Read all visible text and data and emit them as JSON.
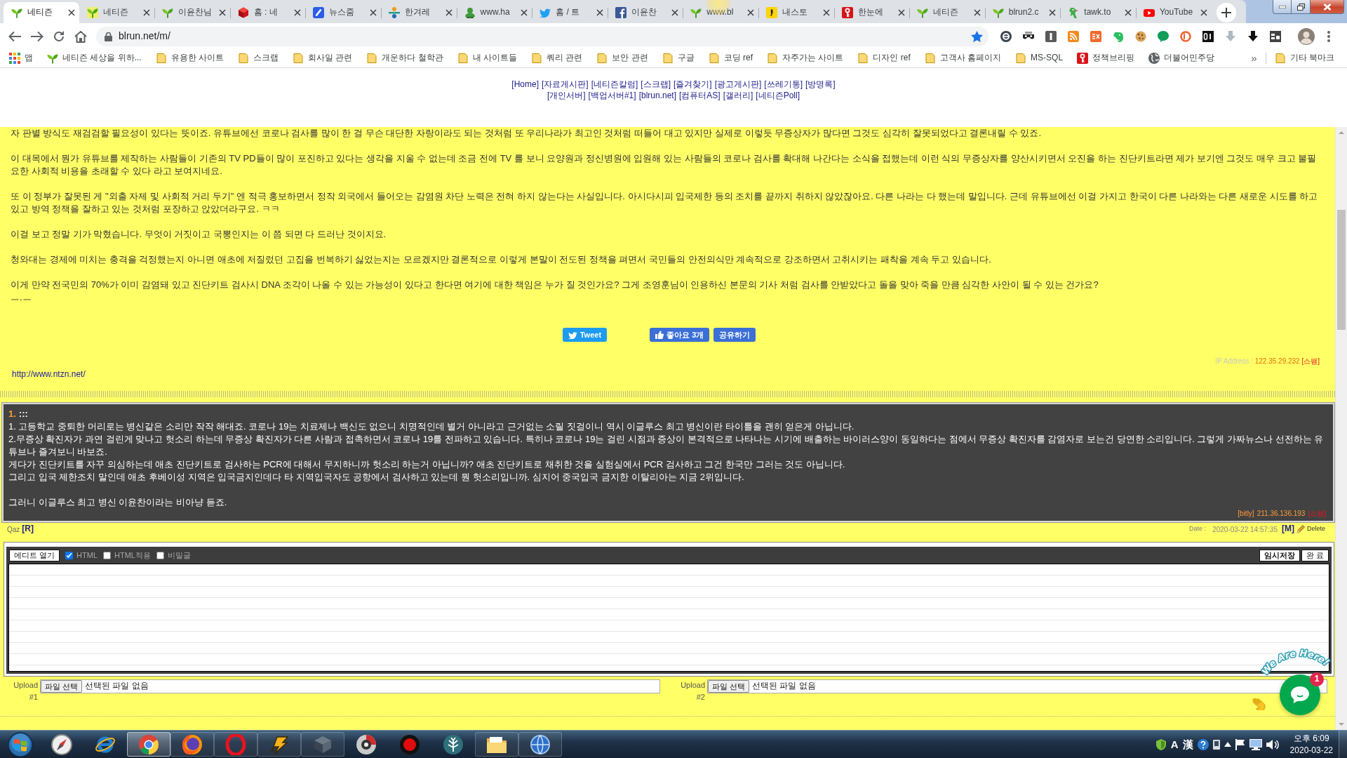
{
  "browser": {
    "tabs": [
      {
        "title": "네티즌",
        "kind": "sprout",
        "selected": true
      },
      {
        "title": "네티즌",
        "kind": "sprout-tile",
        "selected": false
      },
      {
        "title": "이윤찬님",
        "kind": "sprout",
        "selected": false
      },
      {
        "title": "홈 : 네",
        "kind": "cube",
        "selected": false
      },
      {
        "title": "뉴스줌",
        "kind": "slash-tile",
        "selected": false
      },
      {
        "title": "한겨레",
        "kind": "dots-bar",
        "selected": false
      },
      {
        "title": "www.ha",
        "kind": "person",
        "selected": false
      },
      {
        "title": "홈 / 트",
        "kind": "bird",
        "selected": false
      },
      {
        "title": "이윤찬",
        "kind": "f-tile",
        "selected": false
      },
      {
        "title": "www.bl",
        "kind": "sprout",
        "selected": false
      },
      {
        "title": "내스토",
        "kind": "story",
        "selected": false
      },
      {
        "title": "한눈에",
        "kind": "key",
        "selected": false
      },
      {
        "title": "네티즌",
        "kind": "sprout",
        "selected": false
      },
      {
        "title": "blrun2.c",
        "kind": "sprout",
        "selected": false
      },
      {
        "title": "tawk.to",
        "kind": "parrot",
        "selected": false
      },
      {
        "title": "YouTube",
        "kind": "play",
        "selected": false
      }
    ],
    "address": {
      "url": "blrun.net/m/"
    },
    "bookmarks": [
      {
        "label": "앱",
        "kind": "apps"
      },
      {
        "label": "네티즌 세상을 위하...",
        "kind": "sprout"
      },
      {
        "label": "유용한 사이트",
        "kind": "folder"
      },
      {
        "label": "스크랩",
        "kind": "folder"
      },
      {
        "label": "회사일 관련",
        "kind": "folder"
      },
      {
        "label": "개운하다 철학관",
        "kind": "folder"
      },
      {
        "label": "내 사이트들",
        "kind": "folder"
      },
      {
        "label": "쿼리 관련",
        "kind": "folder"
      },
      {
        "label": "보안 관련",
        "kind": "folder"
      },
      {
        "label": "구글",
        "kind": "folder"
      },
      {
        "label": "코딩 ref",
        "kind": "folder"
      },
      {
        "label": "자주가는 사이트",
        "kind": "folder"
      },
      {
        "label": "디자인 ref",
        "kind": "folder"
      },
      {
        "label": "고객사 홈페이지",
        "kind": "folder"
      },
      {
        "label": "MS-SQL",
        "kind": "folder"
      },
      {
        "label": "정책브리핑",
        "kind": "key"
      },
      {
        "label": "더불어민주당",
        "kind": "globe"
      }
    ],
    "bookmarks_more": "»",
    "other_bookmarks": "기타 북마크"
  },
  "site_nav": [
    {
      "links": [
        "[Home]",
        "[자료게시판]",
        "[네티즌칼럼]",
        "[스크랩]",
        "[즐겨찾기]",
        "[광고게시판]",
        "[쓰레기통]",
        "[방명록]"
      ]
    },
    {
      "links": [
        "[개인서버]",
        "[백업서버#1]",
        "[blrun.net]",
        "[컴퓨터AS]",
        "[갤러리]",
        "[네티즌Poll]"
      ]
    }
  ],
  "article": {
    "paragraphs": [
      "자 판별 방식도 재검검할 필요성이 있다는 뜻이죠. 유튜브에선 코로나 검사를 많이 한 걸 무슨 대단한 자랑이라도 되는 것처럼 또 우리나라가 최고인 것처럼 떠들어 대고 있지만 실제로 이렇듯 무증상자가 많다면 그것도 심각히 잘못되었다고 결론내릴 수 있죠.",
      "이 대목에서 뭔가 유튜브를 제작하는 사람들이 기존의 TV PD들이 많이 포진하고 있다는 생각을 지울 수 없는데 조금 전에 TV 를 보니 요양원과 정신병원에 입원해 있는 사람들의 코로나 검사를 확대해 나간다는 소식을 접했는데 이런 식의 무증상자를 양산시키면서 오진을 하는 진단키트라면 제가 보기엔 그것도 매우 크고 불필요한 사회적 비용을 초래할 수 있다 라고 보여지네요.",
      "또 이 정부가 잘못된 게 \"외출 자제 및 사회적 거리 두기\" 엔 적극 홍보하면서 정작 외국에서 들어오는 감염원 차단 노력은 전혀 하지 않는다는 사실입니다. 아시다시피 입국제한 등의 조치를 끝까지 취하지 않았잖아요. 다른 나라는 다 했는데 말입니다. 근데 유튜브에선 이걸 가지고 한국이 다른 나라와는 다른 새로운 시도를 하고 있고 방역 정책을 잘하고 있는 것처럼 포장하고 앉았더라구요. ㅋㅋ",
      "이걸 보고 정말 기가 막혔습니다. 무엇이 거짓이고 국뽕인지는 이 쯤 되면 다 드러난 것이지요.",
      "청와대는 경제에 미치는 충격을 걱정했는지 아니면 애초에 저질렀던 고집을 번복하기 싫었는지는 모르겠지만 결론적으로 이렇게 본말이 전도된 정책을 펴면서 국민들의 안전의식만 계속적으로 강조하면서 고취시키는 패착을 계속 두고 있습니다.",
      "이게 만약 전국민의 70%가 이미 감염돼 있고 진단키트 검사시 DNA 조각이 나올 수 있는 가능성이 있다고 한다면 여기에 대한 책임은 누가 질 것인가요? 그게 조영훈님이 인용하신 본문의 기사 처럼 검사를 안받았다고 돌을 맞아 죽을 만큼 심각한 사안이 될 수 있는 건가요?"
    ],
    "signoff": "ㅡ.ㅡ",
    "share": [
      {
        "label": "Tweet",
        "kind": "twitter"
      },
      {
        "label": "좋아요 3개",
        "kind": "like"
      },
      {
        "label": "공유하기",
        "kind": "share"
      }
    ],
    "ip_label": "IP Address :",
    "ip": "122.35.29.232",
    "spam": "[스팸]",
    "link": "http://www.ntzn.net/"
  },
  "comment": {
    "number": "1.",
    "title": ":::",
    "blocks": [
      {
        "lines": [
          "1. 고등학교 중퇴한 머리로는 병신같은 소리만 작작 해대죠. 코로나 19는 치료제나 백신도 없으니 치명적인데 별거 아니라고 근거없는 소릴 짓걸이니 역시 이글루스 최고 병신이란 타이틀을 괜히 얻은게 아닙니다.",
          "2.무증상 확진자가 과연 걸린게 맞나고 헛소리 하는데 무증상 확진자가 다른 사람과 접촉하면서 코로나 19를 전파하고 있습니다. 특히나 코로나 19는 걸린 시점과 증상이 본격적으로 나타나는 시기에 배출하는 바이러스양이 동일하다는 점에서 무증상 확진자를 감염자로 보는건 당연한 소리입니다. 그렇게 가짜뉴스나 선전하는 유튜브나 즐겨보니 바보죠.",
          "게다가 진단키트를 자꾸 의심하는데 애초 진단키트로 검사하는 PCR에 대해서 무지하니까 헛소리 하는거 아닙니까? 애초 진단키트로 채취한 것을 실험실에서 PCR 검사하고 그건 한국만 그러는 것도 아닙니다.",
          "그리고 입국 제한조치 말인데 애초 후베이성 지역은 입국금지인데다 타 지역입국자도 공항에서 검사하고 있는데 뭔 헛소리입니까. 심지어 중국입국 금지한 이탈리아는 지금 2위입니다."
        ]
      },
      {
        "lines": [
          "그러니 이글루스 최고 병신 이윤찬이라는 비아냥 듣죠."
        ]
      }
    ],
    "source": "[bitly]",
    "ip": "211.36.136.193",
    "spam": "[스팸]",
    "author": "Qaz",
    "reply": "[R]",
    "date_label": "Date :",
    "date": "2020-03-22 14:57:35",
    "modify": "[M]",
    "delete": "Delete"
  },
  "editor": {
    "open_button": "에디트 열기",
    "options": [
      {
        "label": "HTML",
        "checked": true
      },
      {
        "label": "HTML적용",
        "checked": false
      },
      {
        "label": "비밀글",
        "checked": false
      }
    ],
    "buttons": [
      "임시저장",
      "완 료"
    ]
  },
  "uploads": [
    {
      "label": "Upload",
      "number": "#1",
      "button": "파일 선택",
      "status": "선택된 파일 없음"
    },
    {
      "label": "Upload",
      "number": "#2",
      "button": "파일 선택",
      "status": "선택된 파일 없음"
    }
  ],
  "chat_widget": {
    "title": "We Are Here!",
    "unread": "1"
  },
  "taskbar": {
    "apps": [
      {
        "kind": "compass",
        "running": false,
        "selected": false
      },
      {
        "kind": "ring-swoosh",
        "running": false,
        "selected": false
      },
      {
        "kind": "wheel",
        "running": true,
        "selected": true
      },
      {
        "kind": "flame-globe",
        "running": true,
        "selected": false
      },
      {
        "kind": "ring",
        "running": true,
        "selected": false
      },
      {
        "kind": "lightning",
        "running": true,
        "selected": false
      },
      {
        "kind": "book",
        "running": true,
        "selected": false
      },
      {
        "kind": "disc",
        "running": false,
        "selected": false
      },
      {
        "kind": "record",
        "running": false,
        "selected": false
      },
      {
        "kind": "tree",
        "running": false,
        "selected": false
      },
      {
        "kind": "folder",
        "running": true,
        "selected": false
      },
      {
        "kind": "globe",
        "running": true,
        "selected": false
      }
    ],
    "ime": [
      "A",
      "漢"
    ],
    "time": "오후 6:09",
    "date": "2020-03-22"
  }
}
